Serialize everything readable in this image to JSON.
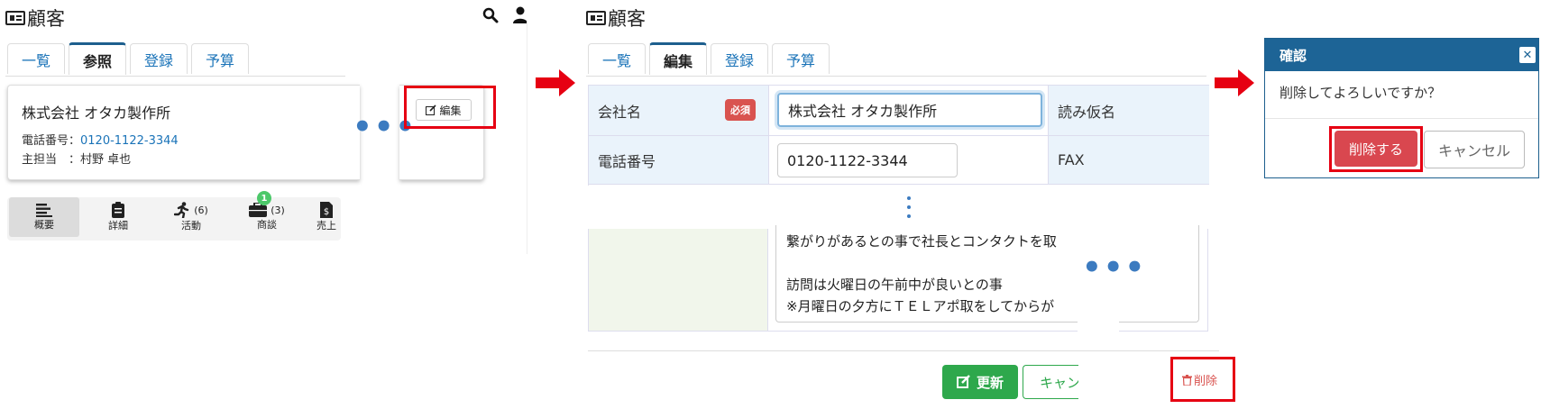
{
  "panel1": {
    "title": "顧客",
    "tabs": [
      "一覧",
      "参照",
      "登録",
      "予算"
    ],
    "company_name": "株式会社 オタカ製作所",
    "phone_label": "電話番号：",
    "phone_value": "0120-1122-3344",
    "owner_label": "主担当　：",
    "owner_value": "村野 卓也",
    "edit_button": "編集",
    "icon_tabs": [
      {
        "label": "概要",
        "icon": "list-icon",
        "count": ""
      },
      {
        "label": "詳細",
        "icon": "clipboard-icon",
        "count": ""
      },
      {
        "label": "活動",
        "icon": "running-icon",
        "count": "(6)"
      },
      {
        "label": "商談",
        "icon": "briefcase-icon",
        "count": "(3)",
        "badge": "1"
      },
      {
        "label": "売上",
        "icon": "invoice-icon",
        "count": ""
      }
    ]
  },
  "panel2": {
    "title": "顧客",
    "tabs": [
      "一覧",
      "編集",
      "登録",
      "予算"
    ],
    "company_label": "会社名",
    "required_badge": "必須",
    "company_value": "株式会社 オタカ製作所",
    "reading_label": "読み仮名",
    "phone_label": "電話番号",
    "phone_value": "0120-1122-3344",
    "fax_label": "FAX",
    "memo_lines": [
      "繋がりがあるとの事で社長とコンタクトを取",
      "",
      "訪問は火曜日の午前中が良いとの事",
      "※月曜日の夕方にＴＥＬアポ取をしてからが"
    ],
    "update_button": "更新",
    "cancel_button": "キャン",
    "delete_link": "削除"
  },
  "panel3": {
    "dialog_title": "確認",
    "message": "削除してよろしいですか？",
    "confirm_button": "削除する",
    "cancel_button": "キャンセル"
  },
  "colors": {
    "highlight": "#e60012",
    "header_blue": "#1d6496",
    "link_blue": "#1a73b8",
    "green": "#2ea84c",
    "danger": "#d9474f"
  }
}
